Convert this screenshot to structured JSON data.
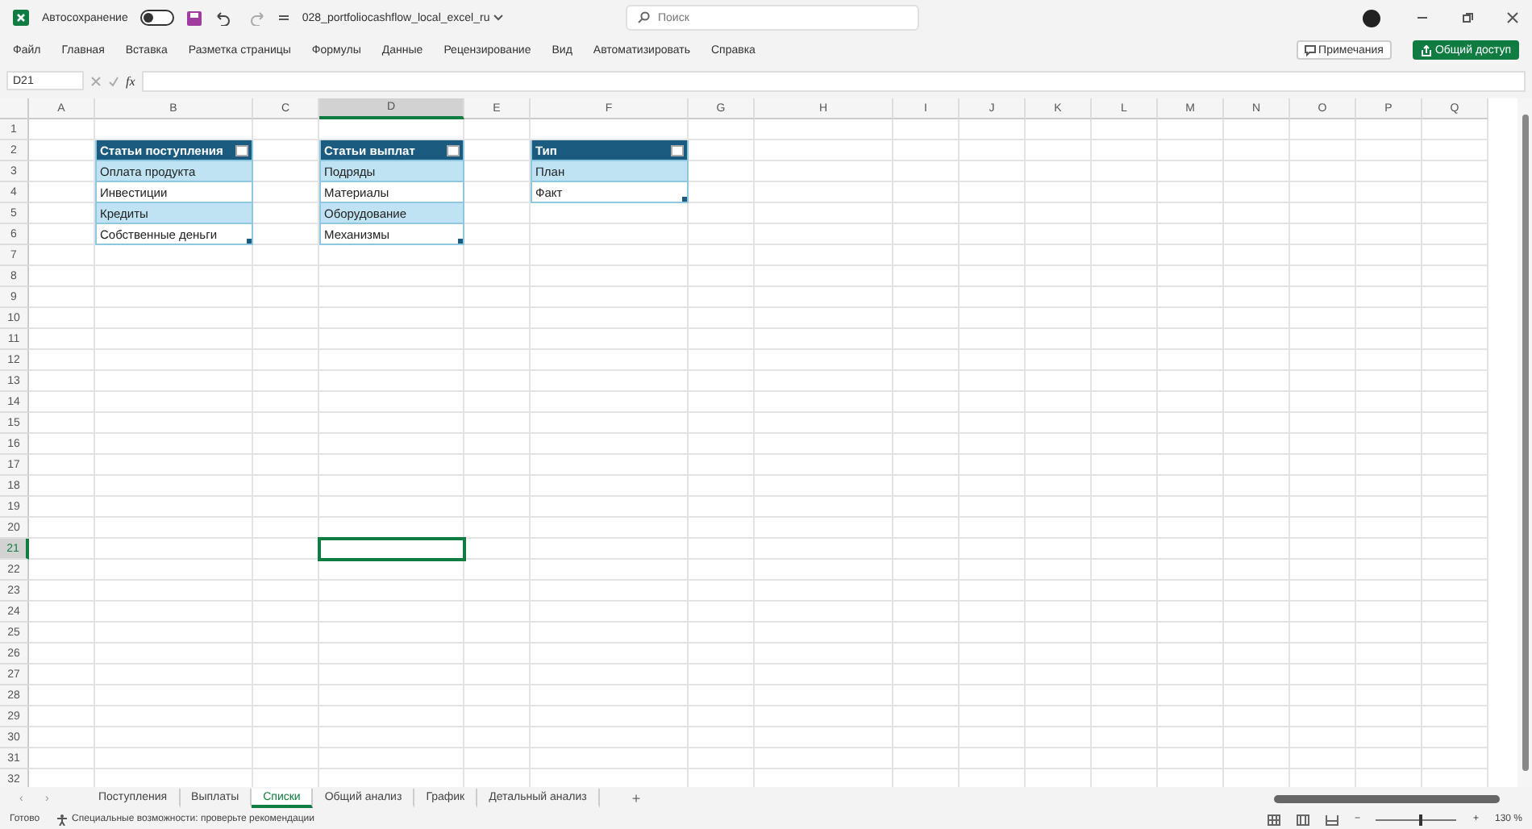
{
  "title_bar": {
    "autosave_label": "Автосохранение",
    "autosave_on": false,
    "file_name": "028_portfoliocashflow_local_excel_ru",
    "search_placeholder": "Поиск"
  },
  "menu": [
    "Файл",
    "Главная",
    "Вставка",
    "Разметка страницы",
    "Формулы",
    "Данные",
    "Рецензирование",
    "Вид",
    "Автоматизировать",
    "Справка"
  ],
  "comments_button": "Примечания",
  "share_button": "Общий доступ",
  "formula_bar": {
    "name_box": "D21",
    "fx": "fx"
  },
  "columns": [
    {
      "label": "A",
      "selected": false
    },
    {
      "label": "B",
      "selected": false
    },
    {
      "label": "C",
      "selected": false
    },
    {
      "label": "D",
      "selected": true
    },
    {
      "label": "E",
      "selected": false
    },
    {
      "label": "F",
      "selected": false
    },
    {
      "label": "G",
      "selected": false
    },
    {
      "label": "H",
      "selected": false
    },
    {
      "label": "I",
      "selected": false
    },
    {
      "label": "J",
      "selected": false
    },
    {
      "label": "K",
      "selected": false
    },
    {
      "label": "L",
      "selected": false
    },
    {
      "label": "M",
      "selected": false
    },
    {
      "label": "N",
      "selected": false
    },
    {
      "label": "O",
      "selected": false
    },
    {
      "label": "P",
      "selected": false
    },
    {
      "label": "Q",
      "selected": false
    }
  ],
  "rows": [
    {
      "label": "1",
      "selected": false
    },
    {
      "label": "2",
      "selected": false
    },
    {
      "label": "3",
      "selected": false
    },
    {
      "label": "4",
      "selected": false
    },
    {
      "label": "5",
      "selected": false
    },
    {
      "label": "6",
      "selected": false
    },
    {
      "label": "7",
      "selected": false
    },
    {
      "label": "8",
      "selected": false
    },
    {
      "label": "9",
      "selected": false
    },
    {
      "label": "10",
      "selected": false
    },
    {
      "label": "11",
      "selected": false
    },
    {
      "label": "12",
      "selected": false
    },
    {
      "label": "13",
      "selected": false
    },
    {
      "label": "14",
      "selected": false
    },
    {
      "label": "15",
      "selected": false
    },
    {
      "label": "16",
      "selected": false
    },
    {
      "label": "17",
      "selected": false
    },
    {
      "label": "18",
      "selected": false
    },
    {
      "label": "19",
      "selected": false
    },
    {
      "label": "20",
      "selected": false
    },
    {
      "label": "21",
      "selected": true
    },
    {
      "label": "22",
      "selected": false
    },
    {
      "label": "23",
      "selected": false
    },
    {
      "label": "24",
      "selected": false
    },
    {
      "label": "25",
      "selected": false
    },
    {
      "label": "26",
      "selected": false
    },
    {
      "label": "27",
      "selected": false
    },
    {
      "label": "28",
      "selected": false
    },
    {
      "label": "29",
      "selected": false
    },
    {
      "label": "30",
      "selected": false
    },
    {
      "label": "31",
      "selected": false
    },
    {
      "label": "32",
      "selected": false
    }
  ],
  "tables": [
    {
      "header": "Статьи поступления",
      "items": [
        "Оплата продукта",
        "Инвестиции",
        "Кредиты",
        "Собственные деньги"
      ]
    },
    {
      "header": "Статьи выплат",
      "items": [
        "Подряды",
        "Материалы",
        "Оборудование",
        "Механизмы"
      ]
    },
    {
      "header": "Тип",
      "items": [
        "План",
        "Факт"
      ]
    }
  ],
  "sheet_nav": {
    "previous": "‹",
    "next": "›",
    "add": "+"
  },
  "sheet_tabs": [
    {
      "label": "Поступления",
      "selected": false
    },
    {
      "label": "Выплаты",
      "selected": false
    },
    {
      "label": "Списки",
      "selected": true
    },
    {
      "label": "Общий анализ",
      "selected": false
    },
    {
      "label": "График",
      "selected": false
    },
    {
      "label": "Детальный анализ",
      "selected": false
    }
  ],
  "status_bar": {
    "ready": "Готово",
    "accessibility": "Специальные возможности: проверьте рекомендации",
    "zoom": {
      "minus": "−",
      "level": 0.55,
      "plus": "+",
      "reading": "130 %"
    }
  }
}
